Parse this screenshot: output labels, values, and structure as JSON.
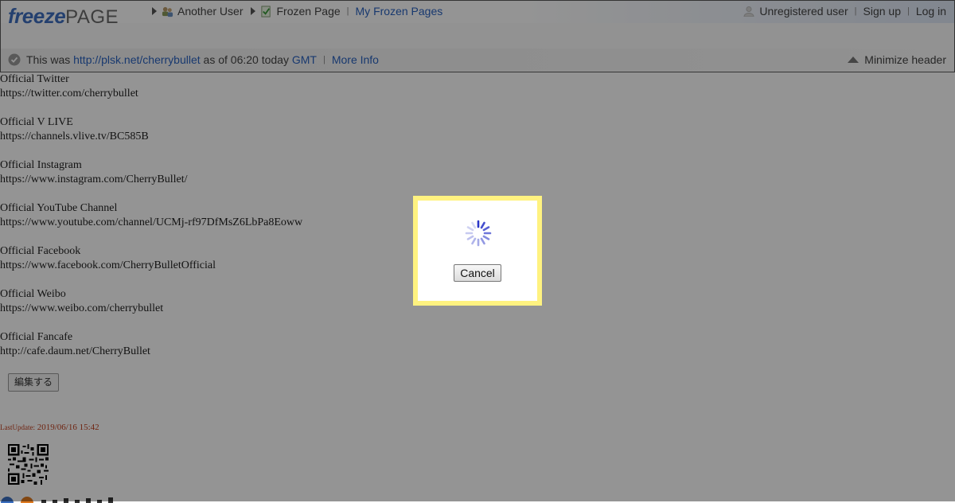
{
  "header": {
    "logo_freeze": "freeze",
    "logo_page": "PAGE",
    "crumb_user": "Another User",
    "crumb_page": "Frozen Page",
    "crumb_separator": "|",
    "my_frozen_pages": "My Frozen Pages",
    "unregistered_user": "Unregistered user",
    "sign_up": "Sign up",
    "log_in": "Log in",
    "info_prefix": "This was",
    "info_url": "http://plsk.net/cherrybullet",
    "info_middle": "as of 06:20 today",
    "info_tz": "GMT",
    "more_info": "More Info",
    "minimize_header": "Minimize header"
  },
  "content": {
    "entries": [
      {
        "title": "Official Twitter",
        "url": "https://twitter.com/cherrybullet"
      },
      {
        "title": "Official V LIVE",
        "url": "https://channels.vlive.tv/BC585B"
      },
      {
        "title": "Official Instagram",
        "url": "https://www.instagram.com/CherryBullet/"
      },
      {
        "title": "Official YouTube Channel",
        "url": "https://www.youtube.com/channel/UCMj-rf97DfMsZ6LbPa8Eoww"
      },
      {
        "title": "Official Facebook",
        "url": "https://www.facebook.com/CherryBulletOfficial"
      },
      {
        "title": "Official Weibo",
        "url": "https://www.weibo.com/cherrybullet"
      },
      {
        "title": "Official Fancafe",
        "url": "http://cafe.daum.net/CherryBullet"
      }
    ],
    "edit_button": "編集する",
    "last_update_label": "LastUpdate:",
    "last_update_value": "2019/06/16 15:42"
  },
  "modal": {
    "cancel_label": "Cancel"
  },
  "colors": {
    "link": "#2a62c0",
    "modal_border": "#fff280",
    "overlay": "rgba(0,0,0,0.42)",
    "spinner": "#3b46d6"
  }
}
